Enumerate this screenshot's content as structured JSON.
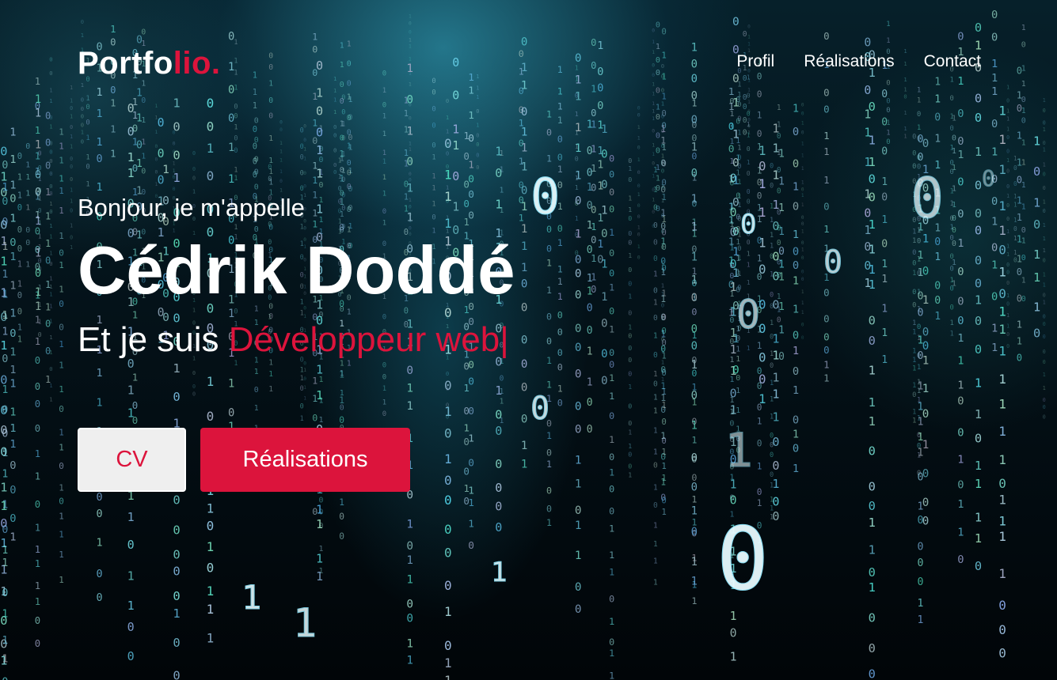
{
  "brand": {
    "logo_main": "Portfo",
    "logo_accent": "lio."
  },
  "nav": {
    "items": [
      {
        "label": "Profil"
      },
      {
        "label": "Réalisations"
      },
      {
        "label": "Contact"
      }
    ]
  },
  "hero": {
    "greeting": "Bonjour, je m'appelle",
    "name": "Cédrik Doddé",
    "role_prefix": "Et je suis ",
    "role": "Développeur web",
    "caret": "|",
    "buttons": {
      "cv_label": "CV",
      "realisations_label": "Réalisations"
    }
  },
  "colors": {
    "accent": "#dc143c",
    "text": "#ffffff",
    "button_light": "#efefef"
  },
  "background": {
    "description_icon": "binary-code-rain-image"
  }
}
